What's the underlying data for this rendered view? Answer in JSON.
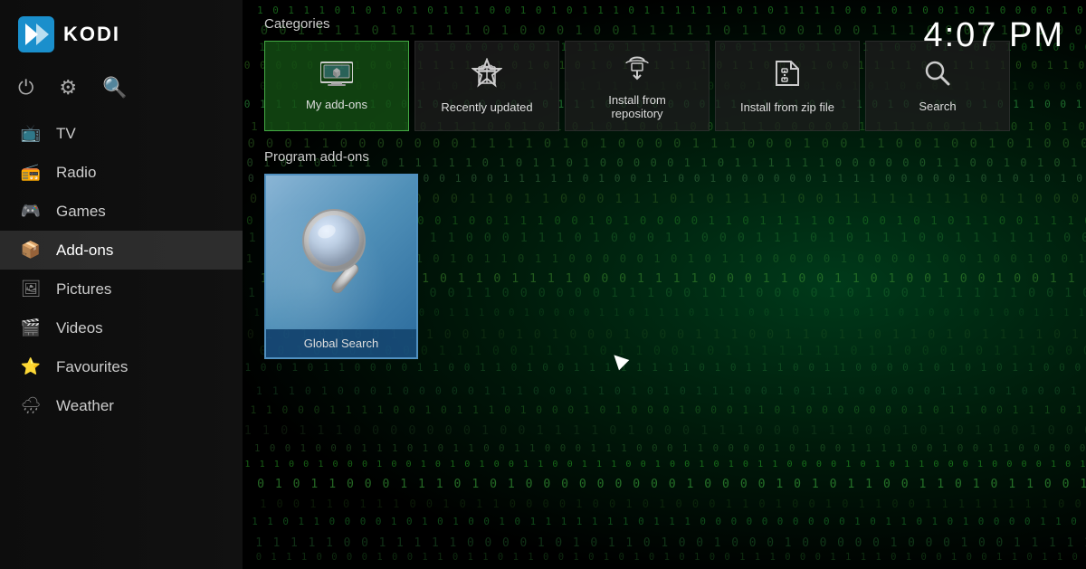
{
  "app": {
    "name": "KODI",
    "time": "4:07 PM"
  },
  "sidebar": {
    "icons": [
      {
        "name": "power-icon",
        "symbol": "⏻"
      },
      {
        "name": "settings-icon",
        "symbol": "⚙"
      },
      {
        "name": "search-icon",
        "symbol": "🔍"
      }
    ],
    "nav_items": [
      {
        "id": "tv",
        "label": "TV",
        "icon": "📺"
      },
      {
        "id": "radio",
        "label": "Radio",
        "icon": "📻"
      },
      {
        "id": "games",
        "label": "Games",
        "icon": "🎮"
      },
      {
        "id": "addons",
        "label": "Add-ons",
        "icon": "📦",
        "active": true
      },
      {
        "id": "pictures",
        "label": "Pictures",
        "icon": "🖼"
      },
      {
        "id": "videos",
        "label": "Videos",
        "icon": "🎬"
      },
      {
        "id": "favourites",
        "label": "Favourites",
        "icon": "⭐"
      },
      {
        "id": "weather",
        "label": "Weather",
        "icon": "🌧"
      }
    ]
  },
  "main": {
    "categories_label": "Categories",
    "categories": [
      {
        "id": "my-addons",
        "label": "My add-ons",
        "icon_type": "monitor"
      },
      {
        "id": "recently-updated",
        "label": "Recently updated",
        "icon_type": "gift"
      },
      {
        "id": "install-from-repo",
        "label": "Install from\nrepository",
        "icon_type": "cloud-download"
      },
      {
        "id": "install-from-zip",
        "label": "Install from zip file",
        "icon_type": "zip"
      },
      {
        "id": "search",
        "label": "Search",
        "icon_type": "search"
      }
    ],
    "program_addons_label": "Program add-ons",
    "addons": [
      {
        "id": "global-search",
        "label": "Global Search"
      }
    ]
  }
}
